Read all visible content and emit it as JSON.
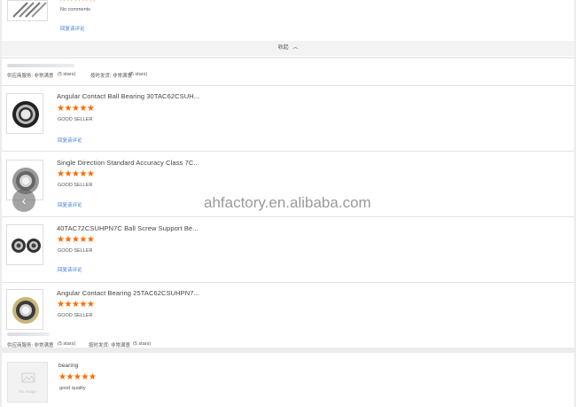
{
  "top_review": {
    "comment": "No comments",
    "reply_link": "回复该评论"
  },
  "collapse": {
    "label": "收起",
    "chevron": "^"
  },
  "group1": {
    "supplier_service": "供应商服务: 非常满意",
    "supplier_stars": "(5 stars)"
  },
  "items": [
    {
      "title": "Angular Contact Ball Bearing 30TAC62CSUH...",
      "stars": 5,
      "seller": "GOOD SELLER",
      "reply_link": "回复该评论"
    },
    {
      "title": "Single Direction Standard Accuracy Class 7C...",
      "stars": 5,
      "seller": "GOOD SELLER",
      "reply_link": "回复该评论"
    },
    {
      "title": "40TAC72CSUHPN7C Ball Screw Support Be...",
      "stars": 5,
      "seller": "GOOD SELLER",
      "reply_link": "回复该评论"
    },
    {
      "title": "Angular Contact Bearing 25TAC62CSUHPN7...",
      "stars": 5,
      "seller": "GOOD SELLER",
      "reply_link": ""
    }
  ],
  "group2": {
    "supplier_service": "供应商服务: 非常满意",
    "supplier_stars": "(5 stars)",
    "ontime": "按时发货: 非常满意",
    "ontime_stars": "(5 stars)"
  },
  "last_item": {
    "title": "bearing",
    "stars": 5,
    "comment": "good quality",
    "placeholder": "No Image"
  },
  "watermark": "ahfactory.en.alibaba.com",
  "star_glyph": "★★★★★",
  "colors": {
    "star": "#ff6a00",
    "link": "#3a7bd5"
  }
}
